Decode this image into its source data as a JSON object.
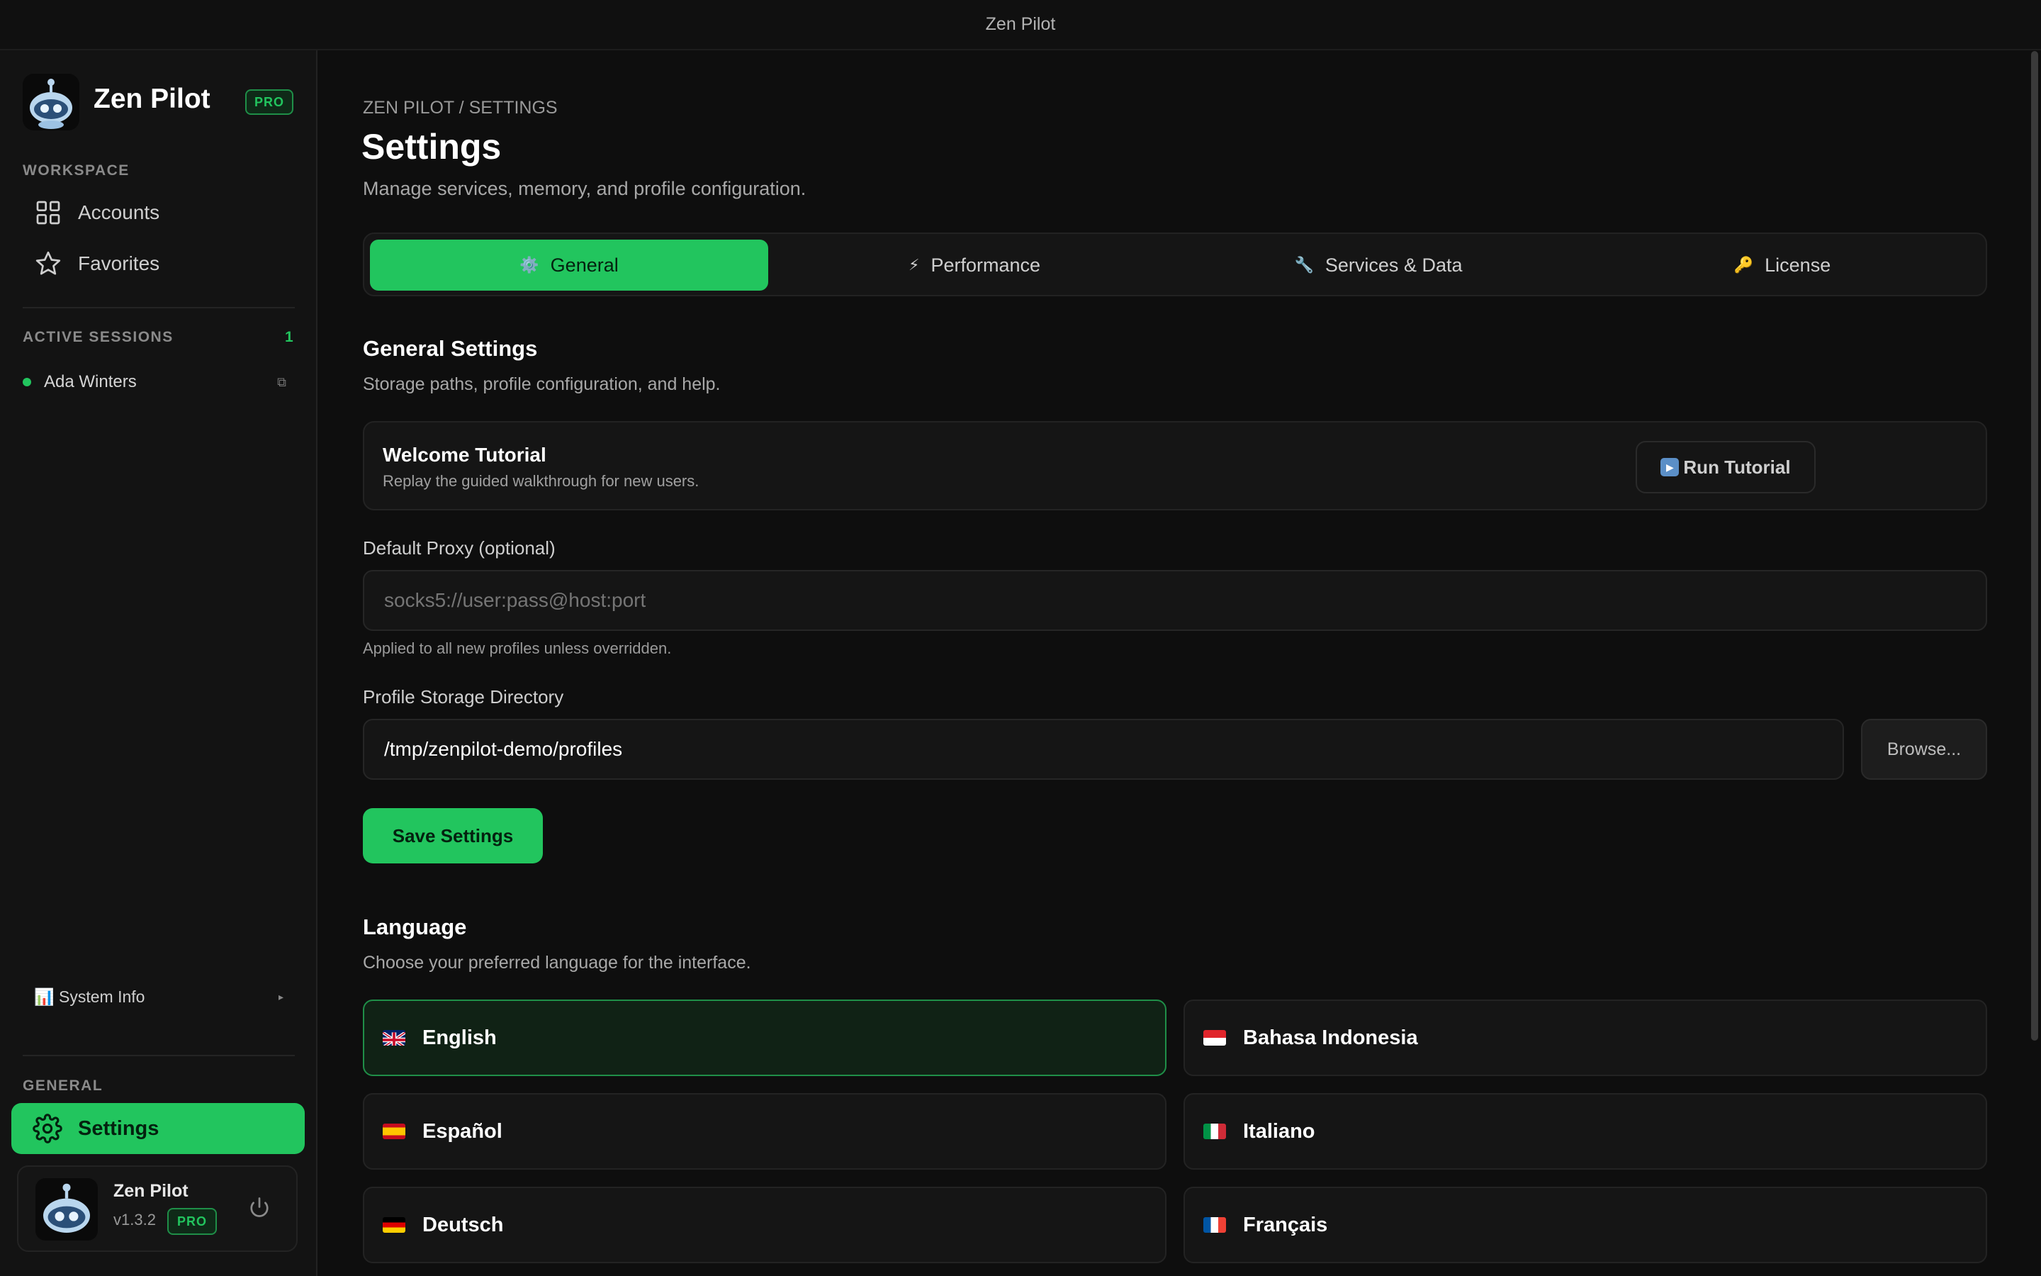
{
  "window": {
    "title": "Zen Pilot"
  },
  "sidebar": {
    "app_name": "Zen Pilot",
    "badge": "PRO",
    "workspace_label": "WORKSPACE",
    "nav": [
      {
        "label": "Accounts",
        "icon": "grid-icon"
      },
      {
        "label": "Favorites",
        "icon": "star-icon"
      }
    ],
    "active_sessions_label": "ACTIVE SESSIONS",
    "active_sessions_count": "1",
    "sessions": [
      {
        "name": "Ada Winters",
        "status_color": "#22c55e"
      }
    ],
    "system_info": "📊 System Info",
    "general_label": "GENERAL",
    "settings_label": "Settings",
    "profile": {
      "name": "Zen Pilot",
      "version": "v1.3.2",
      "badge": "PRO"
    }
  },
  "main": {
    "breadcrumb": "ZEN PILOT / SETTINGS",
    "title": "Settings",
    "subtitle": "Manage services, memory, and profile configuration.",
    "tabs": [
      {
        "label": "General",
        "icon": "⚙️",
        "active": true
      },
      {
        "label": "Performance",
        "icon": "⚡"
      },
      {
        "label": "Services & Data",
        "icon": "🔧"
      },
      {
        "label": "License",
        "icon": "🔑"
      }
    ],
    "general": {
      "heading": "General Settings",
      "description": "Storage paths, profile configuration, and help.",
      "tutorial": {
        "title": "Welcome Tutorial",
        "description": "Replay the guided walkthrough for new users.",
        "button": "Run Tutorial"
      },
      "proxy": {
        "label": "Default Proxy (optional)",
        "placeholder": "socks5://user:pass@host:port",
        "value": "",
        "help": "Applied to all new profiles unless overridden."
      },
      "storage": {
        "label": "Profile Storage Directory",
        "value": "/tmp/zenpilot-demo/profiles",
        "browse": "Browse..."
      },
      "save": "Save Settings"
    },
    "language": {
      "heading": "Language",
      "description": "Choose your preferred language for the interface.",
      "options": [
        {
          "label": "English",
          "flag": "uk-flag",
          "selected": true
        },
        {
          "label": "Bahasa Indonesia",
          "flag": "id-flag"
        },
        {
          "label": "Español",
          "flag": "es-flag"
        },
        {
          "label": "Italiano",
          "flag": "it-flag"
        },
        {
          "label": "Deutsch",
          "flag": "de-flag"
        },
        {
          "label": "Français",
          "flag": "fr-flag"
        }
      ]
    }
  },
  "colors": {
    "accent": "#22c55e",
    "background": "#0d0d0d",
    "panel": "#151515"
  }
}
